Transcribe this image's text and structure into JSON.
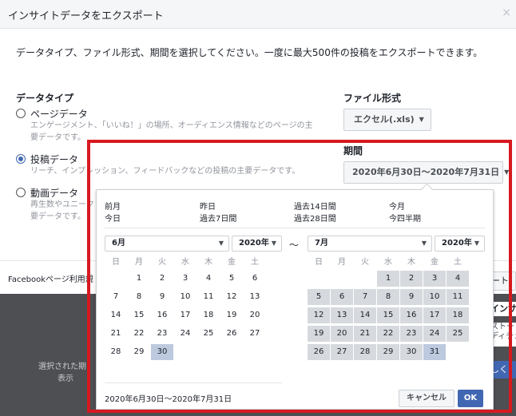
{
  "background": {
    "text_line1": "選択された期",
    "text_line2": "表示",
    "right_tab": "インサ",
    "right_text1": "ストー",
    "right_text2": "ディチェ",
    "right_button": "しく"
  },
  "modal": {
    "title": "インサイトデータをエクスポート",
    "close_icon": "×",
    "description": "データタイプ、ファイル形式、期間を選択してください。一度に最大500件の投稿をエクスポートできます。",
    "data_type": {
      "heading": "データタイプ",
      "options": [
        {
          "label": "ページデータ",
          "sub1": "エンゲージメント、「いいね！」の場所、オーディエンス情報などのページの主",
          "sub2": "要データです。",
          "checked": false
        },
        {
          "label": "投稿データ",
          "sub1": "リーチ、インプレッション、フィードバックなどの投稿の主要データです。",
          "sub2": "",
          "checked": true
        },
        {
          "label": "動画データ",
          "sub1": "再生数やユニーク",
          "sub2": "要データです。",
          "checked": false
        }
      ]
    },
    "file_format": {
      "heading": "ファイル形式",
      "value": "エクセル(.xls)"
    },
    "period": {
      "heading": "期間",
      "value": "2020年6月30日～2020年7月31日"
    },
    "footer_link": "Facebookページ利用規",
    "footer_button": "ート"
  },
  "picker": {
    "presets": {
      "last_month": "前月",
      "today": "今日",
      "yesterday": "昨日",
      "last_7": "過去7日間",
      "last_14": "過去14日間",
      "last_28": "過去28日間",
      "this_month": "今月",
      "this_half": "今四半期"
    },
    "left": {
      "month": "6月",
      "year": "2020年",
      "first_weekday": 1,
      "days_in_month": 30,
      "range_start": 30,
      "range_end": 30
    },
    "right": {
      "month": "7月",
      "year": "2020年",
      "first_weekday": 3,
      "days_in_month": 31,
      "range_start": 1,
      "range_end": 31
    },
    "weekdays": [
      "日",
      "月",
      "火",
      "水",
      "木",
      "金",
      "土"
    ],
    "tilde": "～",
    "range_text": "2020年6月30日～2020年7月31日",
    "cancel_label": "キャンセル",
    "ok_label": "OK"
  },
  "colors": {
    "accent": "#4267b2",
    "highlight_border": "#d71920",
    "range_fill": "#d6d9dd",
    "range_edge": "#bcc9de"
  }
}
